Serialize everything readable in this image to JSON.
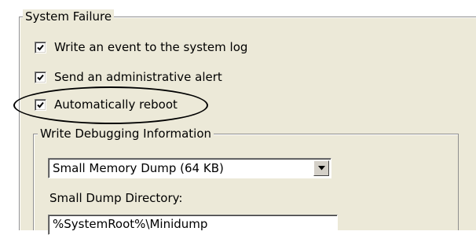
{
  "system_failure": {
    "title": "System Failure",
    "options": [
      {
        "label": "Write an event to the system log",
        "checked": true
      },
      {
        "label": "Send an administrative alert",
        "checked": true
      },
      {
        "label": "Automatically reboot",
        "checked": true
      }
    ]
  },
  "debugging": {
    "title": "Write Debugging Information",
    "dump_type": "Small Memory Dump (64 KB)",
    "dump_dir_label": "Small Dump Directory:",
    "dump_dir_value": "%SystemRoot%\\Minidump"
  },
  "icons": {
    "checkmark": "check-icon",
    "dropdown": "chevron-down-icon"
  }
}
